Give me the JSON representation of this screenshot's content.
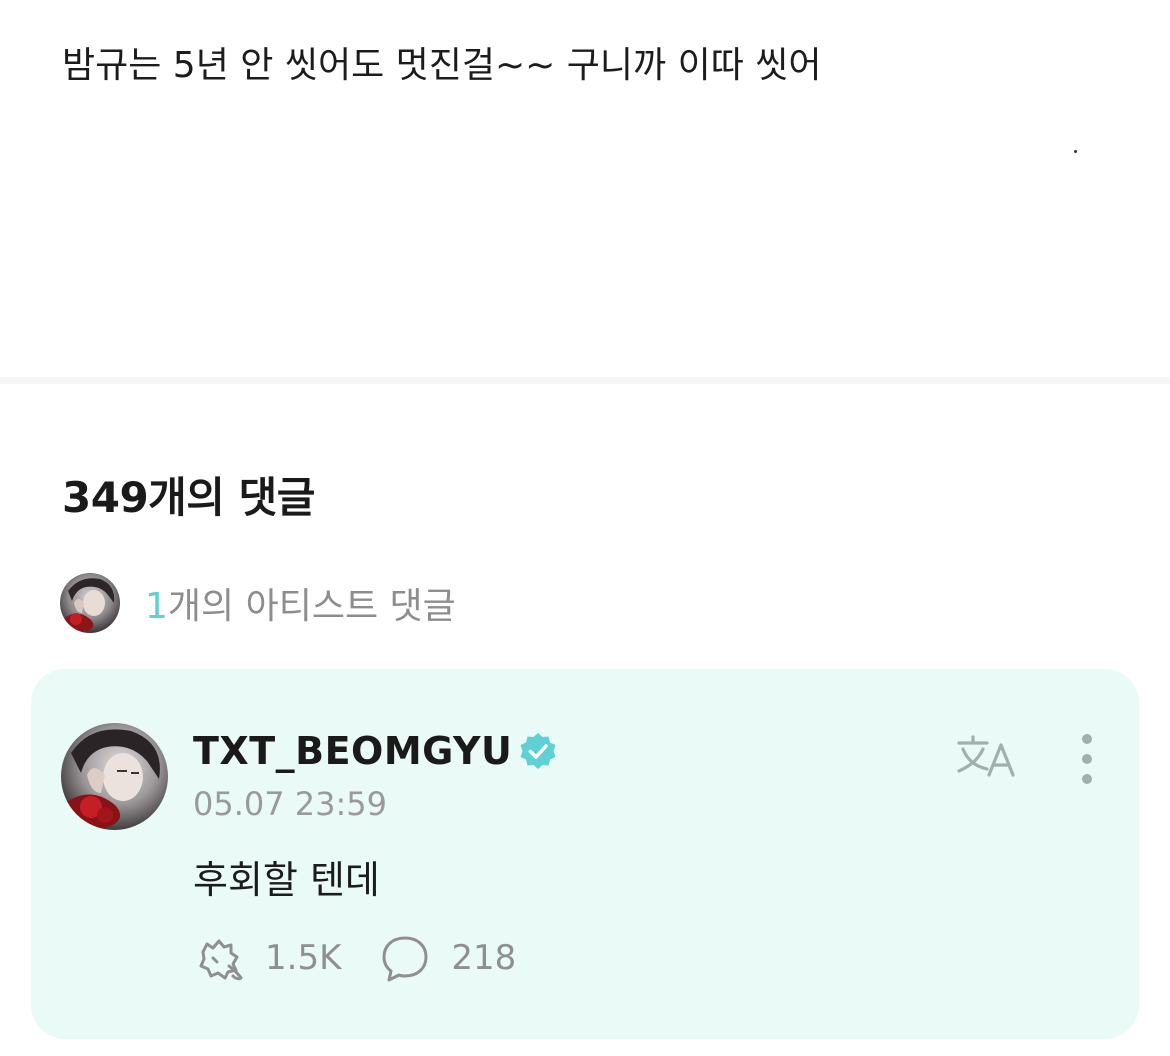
{
  "post": {
    "text": "밤규는 5년 안 씻어도 멋진걸~~ 구니까 이따 씻어"
  },
  "comments": {
    "title": "349개의 댓글",
    "artist_summary": {
      "count": "1",
      "label": "개의 아티스트 댓글"
    }
  },
  "comment": {
    "author": "TXT_BEOMGYU",
    "verified": true,
    "timestamp": "05.07 23:59",
    "body": "후회할 텐데",
    "likes": "1.5K",
    "replies": "218",
    "icons": {
      "avatar": "avatar",
      "verified": "verified-badge-icon",
      "translate": "translate-icon",
      "more": "more-vertical-icon",
      "like": "like-icon",
      "reply": "reply-bubble-icon"
    }
  },
  "colors": {
    "accent": "#5fd1d4",
    "card_bg": "#eafaf7",
    "muted_text": "#8d8d8d",
    "divider": "#f4f5f6"
  }
}
